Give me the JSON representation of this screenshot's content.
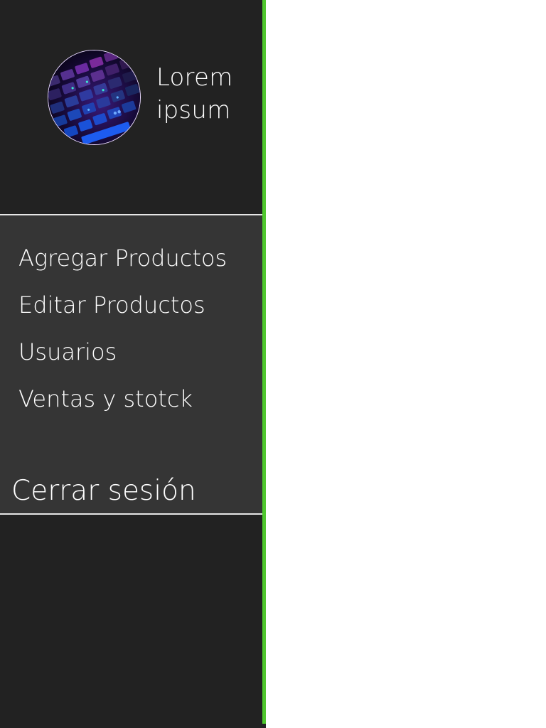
{
  "profile": {
    "name_line1": "Lorem",
    "name_line2": "ipsum",
    "avatar_icon": "keyboard-photo-avatar"
  },
  "menu": {
    "items": [
      {
        "label": "Agregar Productos"
      },
      {
        "label": "Editar Productos"
      },
      {
        "label": "Usuarios"
      },
      {
        "label": "Ventas y stotck"
      }
    ],
    "logout_label": "Cerrar sesión"
  },
  "colors": {
    "sidebar_bg": "#222222",
    "menu_bg": "#353535",
    "accent": "#4fc72e",
    "text": "#ffffff",
    "main_bg": "#ffffff"
  }
}
